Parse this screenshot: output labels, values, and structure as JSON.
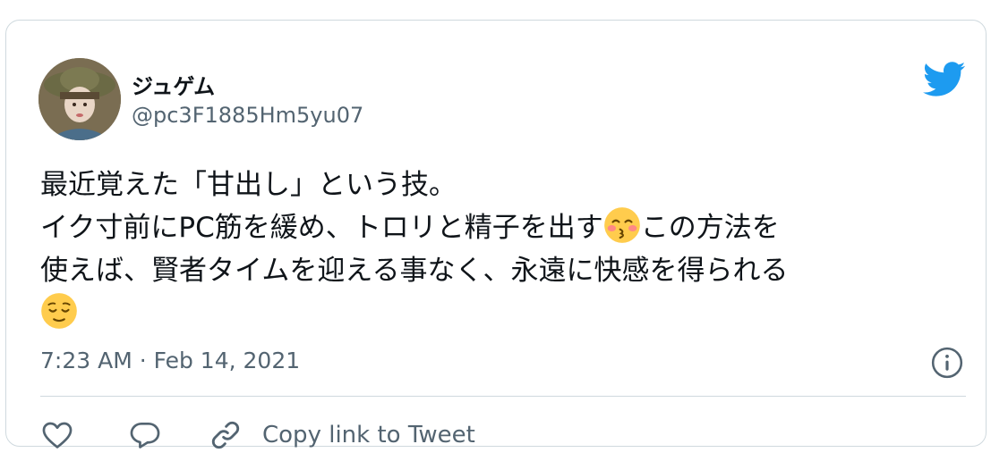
{
  "user": {
    "display_name": "ジュゲム",
    "handle": "@pc3F1885Hm5yu07"
  },
  "tweet": {
    "line1": "最近覚えた「甘出し」という技。",
    "line2_part1": "イク寸前にPC筋を緩め、トロリと精子を出す",
    "line2_part2": "この方法を",
    "line3": "使えば、賢者タイムを迎える事なく、永遠に快感を得られる",
    "emoji1": "kissing-face-with-closed-eyes",
    "emoji2": "relieved-face"
  },
  "timestamp": "7:23 AM · Feb 14, 2021",
  "actions": {
    "copy_link_label": "Copy link to Tweet"
  },
  "colors": {
    "brand": "#1d9bf0",
    "text_primary": "#0f1419",
    "text_secondary": "#536471",
    "border": "#cfd9de",
    "emoji_face": "#ffcc4d"
  },
  "icons": {
    "logo": "twitter-bird-icon",
    "info": "info-icon",
    "like": "heart-icon",
    "reply": "speech-bubble-icon",
    "copy": "link-icon"
  }
}
